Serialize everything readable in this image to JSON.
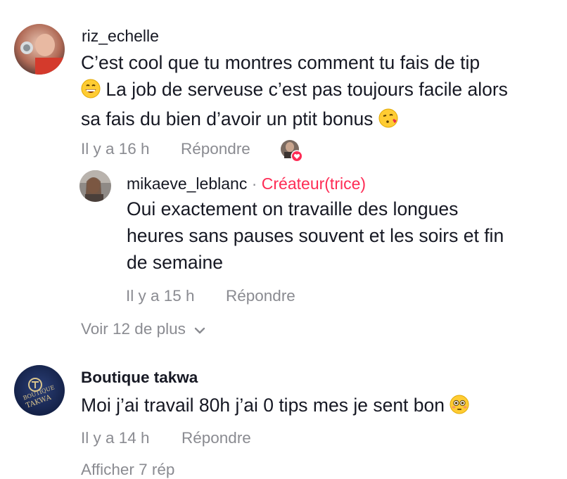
{
  "comments": [
    {
      "username": "riz_echelle",
      "text_line1": "C’est cool que tu montres comment tu fais de tip",
      "text_line2": " La job de serveuse c’est pas toujours facile alors",
      "text_line3": "sa fais du bien d’avoir un ptit bonus ",
      "emoji_1": "grinning-face",
      "emoji_2": "face-blowing-kiss",
      "time": "Il y a 16 h",
      "reply_label": "Répondre",
      "liked_by_creator_icon": "creator-heart-avatar"
    },
    {
      "username": "Boutique takwa",
      "text": "Moi j’ai travail 80h j’ai 0 tips mes je sent bon ",
      "emoji": "flushed-face",
      "time": "Il y a 14 h",
      "reply_label": "Répondre"
    }
  ],
  "reply": {
    "username": "mikaeve_leblanc",
    "separator": "·",
    "creator_tag": "Créateur(trice)",
    "text_line1": "Oui exactement on travaille des longues",
    "text_line2": "heures sans pauses souvent et les soirs et fin",
    "text_line3": "de semaine",
    "time": "Il y a 15 h",
    "reply_label": "Répondre"
  },
  "see_more": {
    "label": "Voir 12 de plus",
    "icon": "chevron-down-icon"
  },
  "cut_off_text": "Afficher 7 rép",
  "colors": {
    "text": "#161823",
    "muted": "#8a8b91",
    "accent": "#fe2c55"
  }
}
